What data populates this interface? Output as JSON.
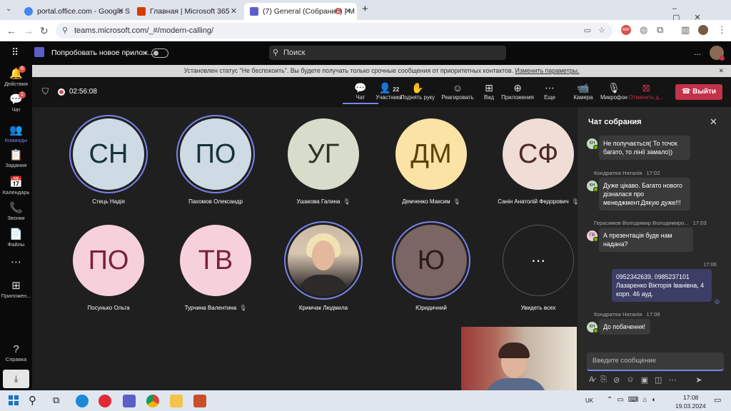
{
  "browser": {
    "tabs": [
      {
        "title": "portal.office.com - Google Sear",
        "favicon_color": "#4285f4"
      },
      {
        "title": "Главная | Microsoft 365",
        "favicon_color": "#d83b01"
      },
      {
        "title": "(7) General (Собрание) | M",
        "favicon_color": "#5b5fc7"
      }
    ],
    "new_tab": "+",
    "url": "teams.microsoft.com/_#/modern-calling/"
  },
  "header": {
    "try_new": "Попробовать новое прилож...",
    "search_placeholder": "Поиск",
    "more": "..."
  },
  "rail": [
    {
      "label": "Действия",
      "badge": "6",
      "icon": "bell-icon",
      "glyph": "🔔"
    },
    {
      "label": "Чат",
      "badge": "1",
      "icon": "chat-icon",
      "glyph": "💬"
    },
    {
      "label": "Команды",
      "badge": "",
      "icon": "teams-icon",
      "glyph": "👥"
    },
    {
      "label": "Задания",
      "badge": "",
      "icon": "assignments-icon",
      "glyph": "📋"
    },
    {
      "label": "Календарь",
      "badge": "",
      "icon": "calendar-icon",
      "glyph": "📅"
    },
    {
      "label": "Звонки",
      "badge": "",
      "icon": "calls-icon",
      "glyph": "📞"
    },
    {
      "label": "Файлы",
      "badge": "",
      "icon": "files-icon",
      "glyph": "📄"
    },
    {
      "label": "",
      "badge": "",
      "icon": "more-icon",
      "glyph": "⋯"
    },
    {
      "label": "Приложен...",
      "badge": "",
      "icon": "apps-icon",
      "glyph": "⊞"
    },
    {
      "label": "Справка",
      "badge": "",
      "icon": "help-icon",
      "glyph": "?"
    }
  ],
  "banner": {
    "text": "Установлен статус \"Не беспокоить\". Вы будете получать только срочные сообщения от приоритетных контактов.",
    "link": "Изменить параметры."
  },
  "call": {
    "timer": "02:56:08",
    "toolbar": [
      {
        "label": "Чат",
        "icon": "chat-icon",
        "glyph": "💬",
        "count": ""
      },
      {
        "label": "Участники",
        "icon": "people-icon",
        "glyph": "👤",
        "count": "22"
      },
      {
        "label": "Поднять руку",
        "icon": "hand-icon",
        "glyph": "✋",
        "count": ""
      },
      {
        "label": "Реагировать",
        "icon": "smile-icon",
        "glyph": "☺",
        "count": ""
      },
      {
        "label": "Вид",
        "icon": "grid-icon",
        "glyph": "⊞",
        "count": ""
      },
      {
        "label": "Приложения",
        "icon": "plus-icon",
        "glyph": "⊕",
        "count": ""
      },
      {
        "label": "Еще",
        "icon": "more-icon",
        "glyph": "⋯",
        "count": ""
      },
      {
        "label": "Камера",
        "icon": "camera-icon",
        "glyph": "📹",
        "count": ""
      },
      {
        "label": "Микрофон",
        "icon": "mic-icon",
        "glyph": "🎙",
        "count": ""
      },
      {
        "label": "Отменить д...",
        "icon": "share-icon",
        "glyph": "⊠",
        "count": ""
      }
    ],
    "leave": "Выйти"
  },
  "participants": [
    {
      "initials": "СН",
      "name": "Стець Надія",
      "bg": "#cfdbe4",
      "fg": "#16323c",
      "muted": false,
      "ring": true,
      "photo": false
    },
    {
      "initials": "ПО",
      "name": "Пахомов Олександр",
      "bg": "#cfdbe4",
      "fg": "#16323c",
      "muted": false,
      "ring": true,
      "photo": false
    },
    {
      "initials": "УГ",
      "name": "Ушакова Галина",
      "bg": "#d8dccb",
      "fg": "#2e3320",
      "muted": true,
      "ring": false,
      "photo": false
    },
    {
      "initials": "ДМ",
      "name": "Демченко Максим",
      "bg": "#fbe3a6",
      "fg": "#5b4205",
      "muted": true,
      "ring": false,
      "photo": false
    },
    {
      "initials": "СФ",
      "name": "Санін Анатолій Федорович",
      "bg": "#f0ddd5",
      "fg": "#4a2a22",
      "muted": true,
      "ring": false,
      "photo": false
    },
    {
      "initials": "ПО",
      "name": "Посунько Ольга",
      "bg": "#f6d1dc",
      "fg": "#7a1f3c",
      "muted": false,
      "ring": false,
      "photo": false
    },
    {
      "initials": "ТВ",
      "name": "Турчина Валентина",
      "bg": "#f6d1dc",
      "fg": "#7a1f3c",
      "muted": true,
      "ring": false,
      "photo": false
    },
    {
      "initials": "",
      "name": "Кримчак Людмила",
      "bg": "#b8a89a",
      "fg": "#000000",
      "muted": false,
      "ring": true,
      "photo": true
    },
    {
      "initials": "Ю",
      "name": "Юридичний",
      "bg": "#7b6663",
      "fg": "#2a1c1b",
      "muted": false,
      "ring": true,
      "photo": false
    },
    {
      "initials": "⋯",
      "name": "Увидеть всех",
      "bg": "#1f1f1f",
      "fg": "#ffffff",
      "muted": false,
      "ring": false,
      "photo": false
    }
  ],
  "chat": {
    "title": "Чат собрания",
    "messages": [
      {
        "avatar": "КН",
        "avatar_bg": "#c7d9c3",
        "author": "",
        "time": "",
        "text": "Не получається( То точок багато, то лінії замало))",
        "mine": false
      },
      {
        "avatar": "КН",
        "avatar_bg": "#c7d9c3",
        "author": "Кондратюк Наталія",
        "time": "17:02",
        "text": "Дуже цікаво. Багато нового дізналася про менеджмент.Дякую дуже!!!",
        "mine": false
      },
      {
        "avatar": "ГВ",
        "avatar_bg": "#f0c9d2",
        "author": "Герасимов Володимир Володимиро...",
        "time": "17:03",
        "text": "А презентація буде нам надана?",
        "mine": false
      },
      {
        "avatar": "",
        "avatar_bg": "",
        "author": "",
        "time": "17:06",
        "text": "0952342639, 0985237101 Лазаренко Вікторія Іванівна, 4 корп. 46 ауд.",
        "mine": true
      },
      {
        "avatar": "КН",
        "avatar_bg": "#c7d9c3",
        "author": "Кондратюк Наталія",
        "time": "17:08",
        "text": "До побачення!",
        "mine": false
      }
    ],
    "compose_placeholder": "Введите сообщение"
  },
  "taskbar": {
    "lang": "UK",
    "time": "17:08",
    "date": "19.03.2024"
  }
}
